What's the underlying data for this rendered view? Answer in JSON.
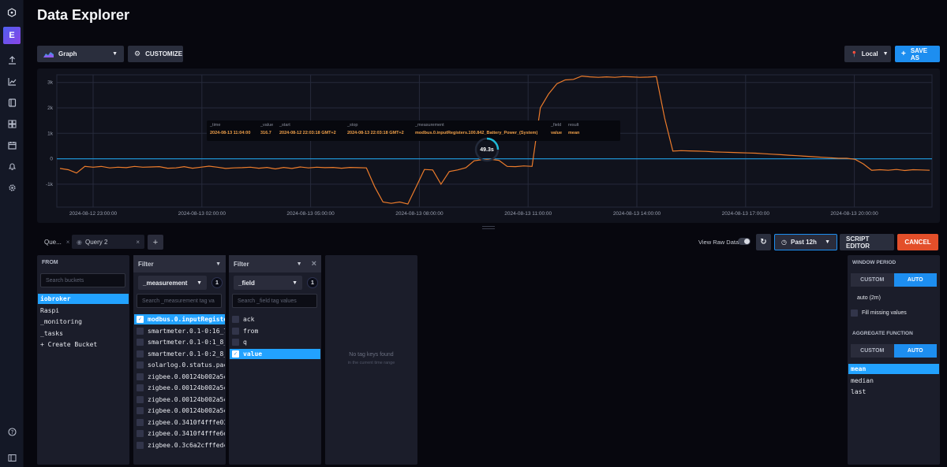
{
  "header": {
    "title": "Data Explorer"
  },
  "nav": {
    "logo_letter": "E"
  },
  "toolbar": {
    "view_type": "Graph",
    "customize": "CUSTOMIZE",
    "timezone": "Local",
    "save_as": "SAVE AS"
  },
  "chart_data": {
    "type": "line",
    "y_ticks": [
      "3k",
      "2k",
      "1k",
      "0",
      "-1k"
    ],
    "ylim": [
      -1900,
      3300
    ],
    "x_ticks": [
      "2024-08-12 23:00:00",
      "2024-08-13 02:00:00",
      "2024-08-13 05:00:00",
      "2024-08-13 08:00:00",
      "2024-08-13 11:00:00",
      "2024-08-13 14:00:00",
      "2024-08-13 17:00:00",
      "2024-08-13 20:00:00"
    ],
    "series": [
      {
        "color": "#ec7b2b",
        "values": [
          -380,
          -430,
          -560,
          -300,
          -330,
          -300,
          -360,
          -330,
          -350,
          -300,
          -330,
          -320,
          -310,
          -370,
          -360,
          -310,
          -370,
          -330,
          -290,
          -330,
          -380,
          -360,
          -350,
          -330,
          -370,
          -340,
          -400,
          -340,
          -380,
          -320,
          -360,
          -330,
          -350,
          -340,
          -370,
          -340,
          -350,
          -360,
          -1100,
          -1700,
          -1750,
          -1700,
          -1780,
          -1100,
          -420,
          -440,
          -1000,
          -500,
          -440,
          -350,
          -80,
          -30,
          -20,
          -60,
          -300,
          -310,
          -280,
          -300,
          2000,
          2550,
          2950,
          3100,
          3120,
          3250,
          3220,
          3200,
          3220,
          3200,
          3230,
          3220,
          3200,
          3210,
          3230,
          1600,
          300,
          320,
          310,
          300,
          290,
          270,
          260,
          250,
          240,
          230,
          220,
          200,
          180,
          160,
          140,
          120,
          100,
          80,
          60,
          40,
          20,
          20,
          -20,
          -200,
          -450,
          -430,
          -450,
          -420,
          -460,
          -430,
          -440,
          -450
        ]
      },
      {
        "color": "#1e8fcf",
        "values": [
          0,
          0
        ]
      }
    ]
  },
  "tooltip": {
    "headers": [
      "_time",
      "_value",
      "_start",
      "_stop",
      "_measurement",
      "_field",
      "result"
    ],
    "values": [
      "2024-08-13 11:04:00",
      "316.7",
      "2024-08-12 22:03:18 GMT+2",
      "2024-08-13 22:03:18 GMT+2",
      "modbus.0.inputRegisters.100.842_Battery_Power_(System)",
      "value",
      "mean"
    ],
    "spinner": "49.3s"
  },
  "queries": {
    "tabs": [
      {
        "label": "Que..."
      },
      {
        "label": "Query 2"
      }
    ],
    "view_raw": "View Raw Data",
    "time_range": "Past 12h",
    "script_editor": "SCRIPT EDITOR",
    "cancel": "CANCEL"
  },
  "from_panel": {
    "title": "FROM",
    "search_placeholder": "Search buckets",
    "buckets": [
      "iobroker",
      "Raspi",
      "_monitoring",
      "_tasks",
      "+ Create Bucket"
    ]
  },
  "filter1": {
    "title": "Filter",
    "key": "_measurement",
    "count": "1",
    "search_placeholder": "Search _measurement tag va",
    "values": [
      "modbus.0.inputRegiste…",
      "smartmeter.0.1-0:16_7…",
      "smartmeter.0.1-0:1_8_…",
      "smartmeter.0.1-0:2_8_…",
      "solarlog.0.status.pac",
      "zigbee.0.00124b002a5c…",
      "zigbee.0.00124b002a5c…",
      "zigbee.0.00124b002a5c…",
      "zigbee.0.00124b002a5c…",
      "zigbee.0.3410f4fffe03…",
      "zigbee.0.3410f4fffe6d…",
      "zigbee.0.3c6a2cfffed4…"
    ]
  },
  "filter2": {
    "title": "Filter",
    "key": "_field",
    "count": "1",
    "search_placeholder": "Search _field tag values",
    "values": [
      "ack",
      "from",
      "q",
      "value"
    ]
  },
  "empty_panel": {
    "title": "No tag keys found",
    "subtitle": "in the current time range"
  },
  "window": {
    "title": "WINDOW PERIOD",
    "custom": "CUSTOM",
    "auto": "AUTO",
    "value": "auto (2m)",
    "fill_missing": "Fill missing values",
    "agg_title": "AGGREGATE FUNCTION",
    "functions": [
      "mean",
      "median",
      "last"
    ]
  }
}
